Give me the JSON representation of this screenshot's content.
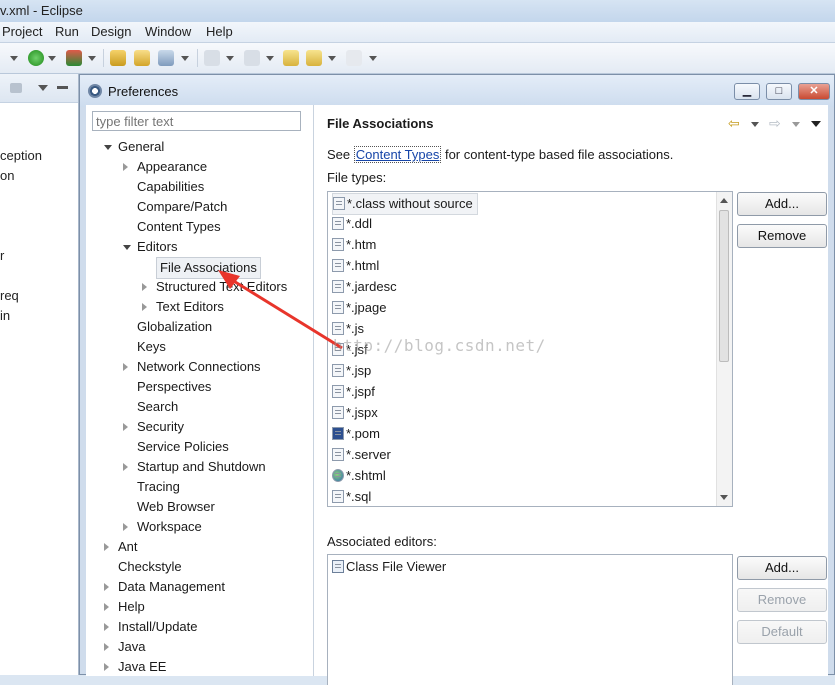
{
  "window": {
    "title": "v.xml - Eclipse"
  },
  "menubar": [
    "Project",
    "Run",
    "Design",
    "Window",
    "Help"
  ],
  "left_view": {
    "fragments": [
      "ception",
      "on",
      "r",
      "req",
      "in"
    ]
  },
  "dialog": {
    "title": "Preferences",
    "filter_placeholder": "type filter text",
    "tree": [
      {
        "label": "General",
        "state": "expanded"
      },
      {
        "label": "Appearance",
        "state": "collapsed"
      },
      {
        "label": "Capabilities",
        "state": "leaf"
      },
      {
        "label": "Compare/Patch",
        "state": "leaf"
      },
      {
        "label": "Content Types",
        "state": "leaf"
      },
      {
        "label": "Editors",
        "state": "expanded"
      },
      {
        "label": "File Associations",
        "state": "leaf",
        "selected": true
      },
      {
        "label": "Structured Text Editors",
        "state": "collapsed"
      },
      {
        "label": "Text Editors",
        "state": "collapsed"
      },
      {
        "label": "Globalization",
        "state": "leaf"
      },
      {
        "label": "Keys",
        "state": "leaf"
      },
      {
        "label": "Network Connections",
        "state": "collapsed"
      },
      {
        "label": "Perspectives",
        "state": "leaf"
      },
      {
        "label": "Search",
        "state": "leaf"
      },
      {
        "label": "Security",
        "state": "collapsed"
      },
      {
        "label": "Service Policies",
        "state": "leaf"
      },
      {
        "label": "Startup and Shutdown",
        "state": "collapsed"
      },
      {
        "label": "Tracing",
        "state": "leaf"
      },
      {
        "label": "Web Browser",
        "state": "leaf"
      },
      {
        "label": "Workspace",
        "state": "collapsed"
      },
      {
        "label": "Ant",
        "state": "collapsed"
      },
      {
        "label": "Checkstyle",
        "state": "leaf"
      },
      {
        "label": "Data Management",
        "state": "collapsed"
      },
      {
        "label": "Help",
        "state": "collapsed"
      },
      {
        "label": "Install/Update",
        "state": "collapsed"
      },
      {
        "label": "Java",
        "state": "collapsed"
      },
      {
        "label": "Java EE",
        "state": "collapsed"
      }
    ],
    "page": {
      "title": "File Associations",
      "desc_prefix": "See ",
      "desc_link": "Content Types",
      "desc_suffix": " for content-type based file associations.",
      "file_types_label": "File types:",
      "file_types": [
        "*.class without source",
        "*.ddl",
        "*.htm",
        "*.html",
        "*.jardesc",
        "*.jpage",
        "*.js",
        "*.jsf",
        "*.jsp",
        "*.jspf",
        "*.jspx",
        "*.pom",
        "*.server",
        "*.shtml",
        "*.sql"
      ],
      "associated_editors_label": "Associated editors:",
      "associated_editors": [
        "Class File Viewer"
      ],
      "buttons": {
        "types_add": "Add...",
        "types_remove": "Remove",
        "editors_add": "Add...",
        "editors_remove": "Remove",
        "editors_default": "Default"
      }
    }
  },
  "watermark": "http://blog.csdn.net/",
  "colors": {
    "arrow": "#e8352b",
    "link": "#1645a8",
    "selection_bg": "#eef1f5"
  }
}
